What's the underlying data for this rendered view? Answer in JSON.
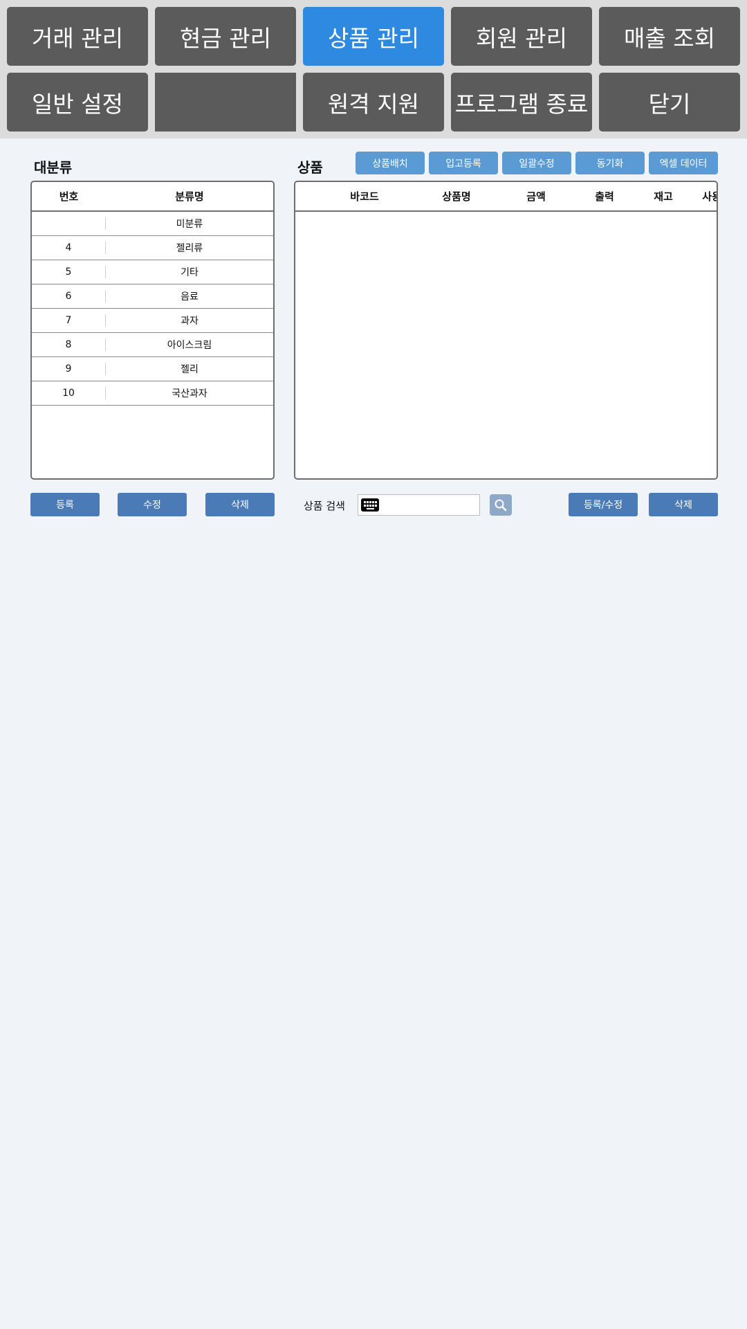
{
  "nav": {
    "row1": [
      "거래 관리",
      "현금 관리",
      "상품 관리",
      "회원 관리",
      "매출 조회"
    ],
    "row2": [
      "일반 설정",
      "",
      "원격 지원",
      "프로그램 종료",
      "닫기"
    ],
    "active": "상품 관리"
  },
  "category": {
    "title": "대분류",
    "headers": {
      "number": "번호",
      "name": "분류명"
    },
    "rows": [
      {
        "number": "",
        "name": "미분류"
      },
      {
        "number": "4",
        "name": "젤리류"
      },
      {
        "number": "5",
        "name": "기타"
      },
      {
        "number": "6",
        "name": "음료"
      },
      {
        "number": "7",
        "name": "과자"
      },
      {
        "number": "8",
        "name": "아이스크림"
      },
      {
        "number": "9",
        "name": "젤리"
      },
      {
        "number": "10",
        "name": "국산과자"
      }
    ]
  },
  "product": {
    "title": "상품",
    "toolbar": [
      "상품배치",
      "입고등록",
      "일괄수정",
      "동기화",
      "엑셀 데이터"
    ],
    "headers": {
      "barcode": "바코드",
      "name": "상품명",
      "price": "금액",
      "print": "출력",
      "stock": "재고",
      "use": "사용"
    }
  },
  "bottom": {
    "register": "등록",
    "edit": "수정",
    "delete": "삭제",
    "search_label": "상품 검색",
    "search_value": "",
    "product_register": "등록/수정",
    "product_delete": "삭제"
  },
  "colors": {
    "nav_bg": "#5b5b5b",
    "nav_active": "#2d8ae0",
    "toolbar_btn": "#5b9bd5",
    "action_btn": "#4a7bb7",
    "page_bg": "#f0f3f8"
  }
}
